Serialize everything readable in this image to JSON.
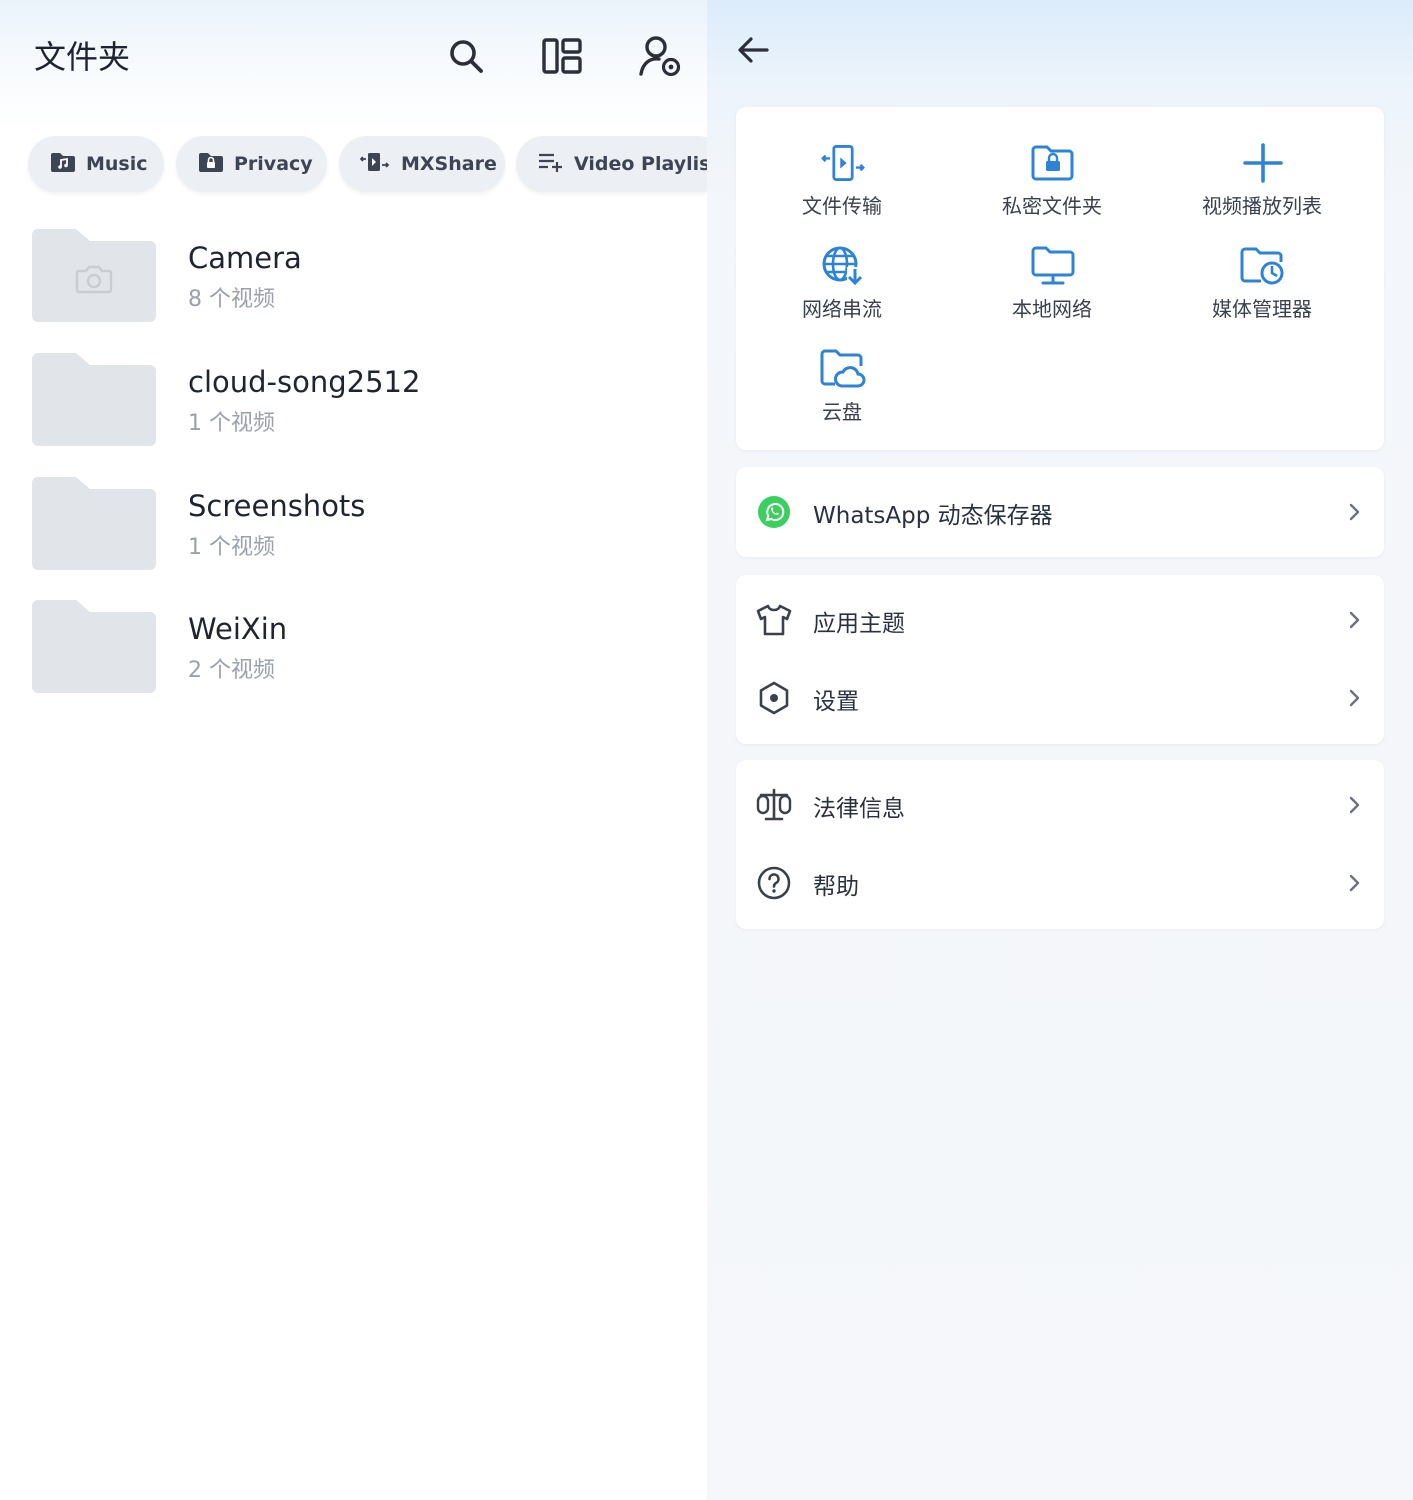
{
  "left_panel": {
    "title": "文件夹",
    "top_icons": [
      "search-icon",
      "layout-grid-icon",
      "account-settings-icon"
    ],
    "chips": [
      {
        "label": "Music",
        "icon": "music-folder-icon"
      },
      {
        "label": "Privacy",
        "icon": "lock-folder-icon"
      },
      {
        "label": "MXShare",
        "icon": "transfer-icon"
      },
      {
        "label": "Video Playlist",
        "icon": "playlist-add-icon"
      }
    ],
    "folders": [
      {
        "name": "Camera",
        "count": "8 个视频",
        "icon": "camera-icon"
      },
      {
        "name": "cloud-song2512",
        "count": "1 个视频"
      },
      {
        "name": "Screenshots",
        "count": "1 个视频"
      },
      {
        "name": "WeiXin",
        "count": "2 个视频"
      }
    ]
  },
  "right_panel": {
    "back_icon": "arrow-left-icon",
    "grid": [
      {
        "label": "文件传输",
        "icon": "file-transfer-icon"
      },
      {
        "label": "私密文件夹",
        "icon": "private-folder-icon"
      },
      {
        "label": "视频播放列表",
        "icon": "plus-icon"
      },
      {
        "label": "网络串流",
        "icon": "globe-download-icon"
      },
      {
        "label": "本地网络",
        "icon": "monitor-icon"
      },
      {
        "label": "媒体管理器",
        "icon": "media-manager-icon"
      },
      {
        "label": "云盘",
        "icon": "cloud-folder-icon"
      }
    ],
    "whatsapp": {
      "label": "WhatsApp 动态保存器",
      "icon": "whatsapp-icon"
    },
    "group1": [
      {
        "label": "应用主题",
        "icon": "tshirt-icon"
      },
      {
        "label": "设置",
        "icon": "settings-icon"
      }
    ],
    "group2": [
      {
        "label": "法律信息",
        "icon": "scales-icon"
      },
      {
        "label": "帮助",
        "icon": "help-icon"
      }
    ],
    "accent_color": "#2e83d6",
    "whatsapp_color": "#3ccf5f"
  }
}
